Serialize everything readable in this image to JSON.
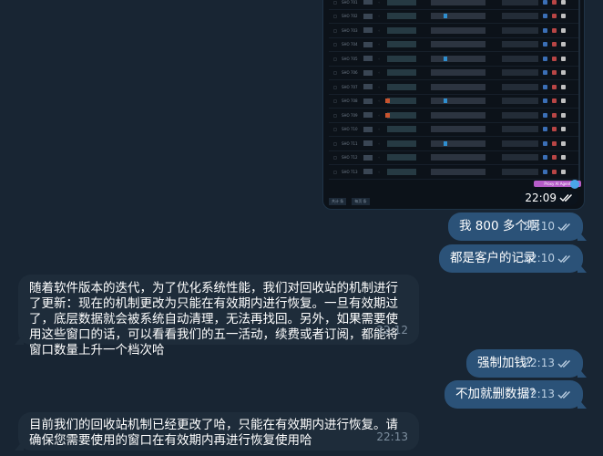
{
  "image_message": {
    "time": "22:09",
    "sticker_label": "Proxy AI Agent",
    "screenshot_row_ids": [
      "SHO 701",
      "SHO 702",
      "SHO 703",
      "SHO 704",
      "SHO 705",
      "SHO 706",
      "SHO 707",
      "SHO 708",
      "SHO 709",
      "SHO 710",
      "SHO 711",
      "SHO 712",
      "SHO 713"
    ],
    "footer_items": [
      "共计 条",
      "每页 条"
    ]
  },
  "messages": [
    {
      "id": "m1",
      "direction": "out",
      "text": "我 800 多个啊",
      "time": "22:10"
    },
    {
      "id": "m2",
      "direction": "out",
      "text": "都是客户的记录",
      "time": "22:10"
    },
    {
      "id": "m3",
      "direction": "in",
      "text": "随着软件版本的迭代，为了优化系统性能，我们对回收站的机制进行了更新：现在的机制更改为只能在有效期内进行恢复。一旦有效期过了，底层数据就会被系统自动清理，无法再找回。另外，如果需要使用这些窗口的话，可以看看我们的五一活动，续费或者订阅，都能将窗口数量上升一个档次哈",
      "time": "22:12"
    },
    {
      "id": "m4",
      "direction": "out",
      "text": "强制加钱？",
      "time": "22:13"
    },
    {
      "id": "m5",
      "direction": "out",
      "text": "不加就删数据？",
      "time": "22:13"
    },
    {
      "id": "m6",
      "direction": "in",
      "text": "目前我们的回收站机制已经更改了哈，只能在有效期内进行恢复。请确保您需要使用的窗口在有效期内再进行恢复使用哈",
      "time": "22:13"
    }
  ],
  "colors": {
    "background": "#182533",
    "outgoing_bubble": "#2b5278",
    "incoming_bubble": "#1e2c3a"
  }
}
